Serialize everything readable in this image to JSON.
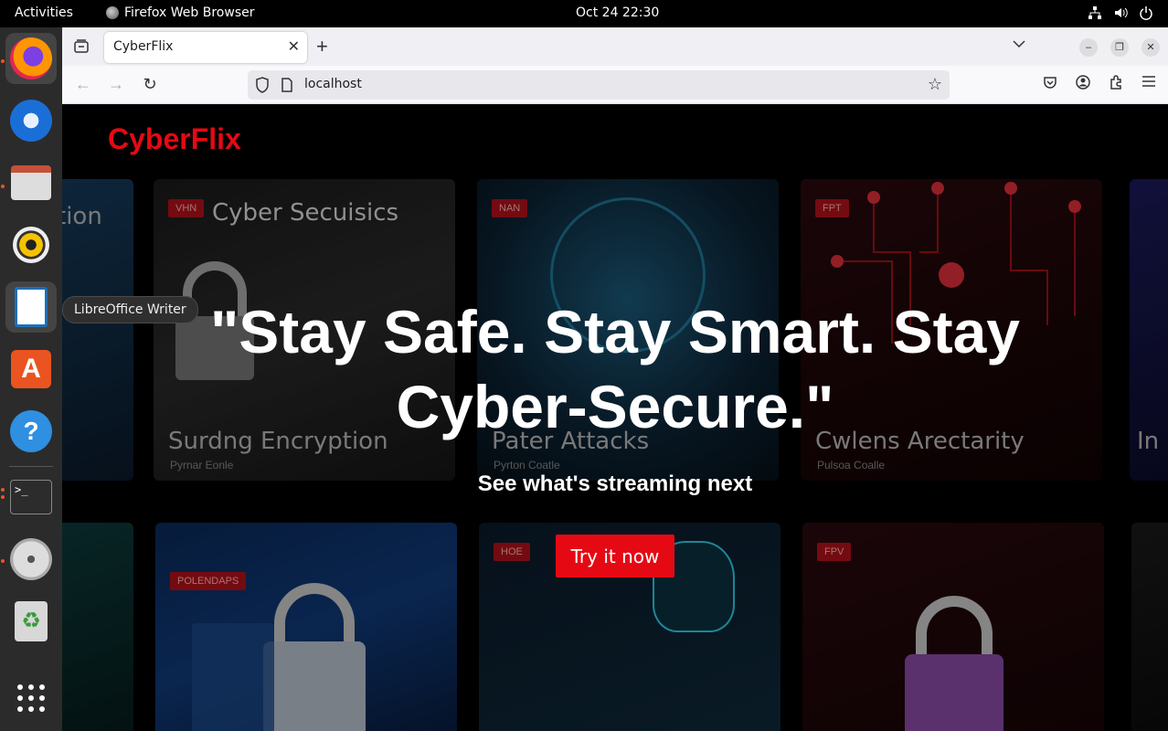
{
  "topbar": {
    "activities": "Activities",
    "app_name": "Firefox Web Browser",
    "clock": "Oct 24  22:30"
  },
  "dock": {
    "tooltip": "LibreOffice Writer",
    "items": [
      "Firefox",
      "Thunderbird",
      "Files",
      "Rhythmbox",
      "LibreOffice Writer",
      "Ubuntu Software",
      "Help",
      "Terminal",
      "DVD",
      "Trash",
      "Show Applications"
    ]
  },
  "browser": {
    "tab_title": "CyberFlix",
    "url": "localhost"
  },
  "page": {
    "logo": "CyberFlix",
    "hero_title": "\"Stay Safe. Stay Smart. Stay Cyber-Secure.\"",
    "hero_subtitle": "See what's streaming next",
    "cta_label": "Try it now",
    "posters_top": [
      {
        "title": "tion",
        "sub": ""
      },
      {
        "title": "Cyber Secuisics",
        "tag": "VHN",
        "bottom_title": "Surdng Encryption",
        "sub": "Pyrnar Eonle"
      },
      {
        "title": "",
        "tag": "NAN",
        "bottom_title": "Pater Attacks",
        "sub": "Pyrton Coatle"
      },
      {
        "title": "",
        "tag": "FPT",
        "bottom_title": "Cwlens Arectarity",
        "sub": "Pulsoa Coalle"
      },
      {
        "title": "In",
        "sub": ""
      }
    ],
    "posters_bottom": [
      {
        "tag": ""
      },
      {
        "tag": "POLENDAPS"
      },
      {
        "tag": "HOE"
      },
      {
        "tag": "FPV"
      },
      {
        "tag": ""
      }
    ]
  }
}
